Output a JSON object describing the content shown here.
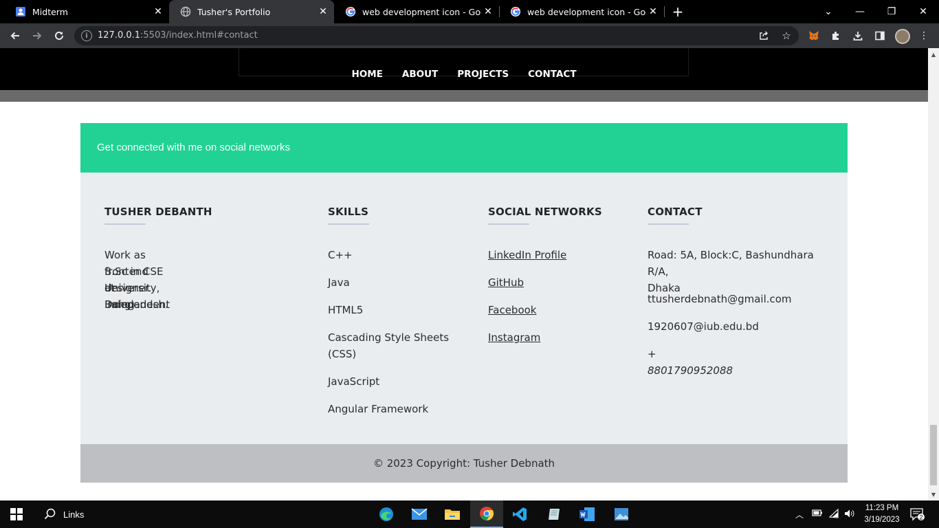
{
  "browser": {
    "tabs": [
      {
        "title": "Midterm",
        "icon": "person-badge-icon"
      },
      {
        "title": "Tusher's Portfolio",
        "icon": "globe-icon",
        "active": true
      },
      {
        "title": "web development icon - Google",
        "icon": "google-icon"
      },
      {
        "title": "web development icon - Google",
        "icon": "google-icon"
      }
    ],
    "address": {
      "host": "127.0.0.1",
      "rest": ":5503/index.html#contact"
    }
  },
  "nav": {
    "links": [
      "HOME",
      "ABOUT",
      "PROJECTS",
      "CONTACT"
    ]
  },
  "social_banner": "Get connected with me on social networks",
  "footer": {
    "about": {
      "heading": "TUSHER DEBANTH",
      "text_lines": [
        "Work as frontend designer. Doing",
        "B.Sc in CSE at Independent",
        "University, Bangladesh."
      ]
    },
    "skills": {
      "heading": "SKILLS",
      "items": [
        "C++",
        "Java",
        "HTML5",
        "Cascading Style Sheets",
        "(CSS)",
        "JavaScript",
        "Angular Framework"
      ]
    },
    "social": {
      "heading": "SOCIAL NETWORKS",
      "links": [
        "LinkedIn Profile",
        "GitHub",
        "Facebook",
        "Instagram"
      ]
    },
    "contact": {
      "heading": "CONTACT",
      "address_lines": [
        "Road: 5A, Block:C, Bashundhara",
        "R/A, Dhaka"
      ],
      "email1": "ttusherdebnath@gmail.com",
      "email2": "1920607@iub.edu.bd",
      "phone": "+ 8801790952088"
    }
  },
  "copyright": "© 2023 Copyright: Tusher Debnath",
  "taskbar": {
    "search_label": "Links",
    "time": "11:23 PM",
    "date": "3/19/2023",
    "notifications": "2"
  },
  "colors": {
    "banner": "#22d295",
    "footer_bg": "#eaedf0",
    "copyright_bg": "#bdbfc2"
  }
}
